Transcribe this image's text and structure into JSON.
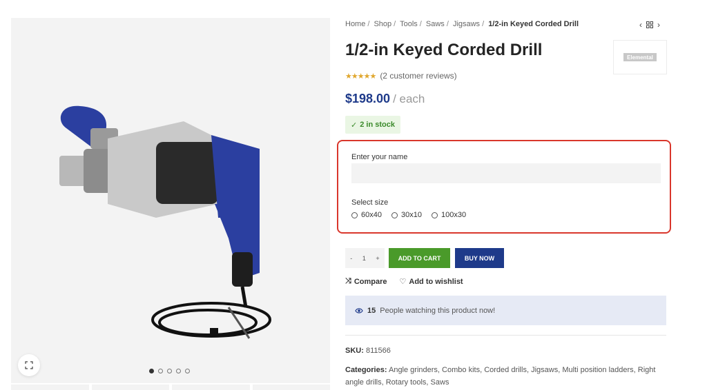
{
  "breadcrumb": [
    "Home",
    "Shop",
    "Tools",
    "Saws",
    "Jigsaws"
  ],
  "breadcrumb_current": "1/2-in Keyed Corded Drill",
  "brand": "Elemental",
  "product": {
    "title": "1/2-in Keyed Corded Drill",
    "rating": 4.5,
    "reviews": "(2 customer reviews)",
    "price": "$198.00",
    "unit": "/ each",
    "stock": "2 in stock"
  },
  "form": {
    "name_label": "Enter your name",
    "size_label": "Select size",
    "sizes": [
      "60x40",
      "30x10",
      "100x30"
    ]
  },
  "cart": {
    "minus": "-",
    "quantity": "1",
    "plus": "+",
    "add_to_cart": "ADD TO CART",
    "buy_now": "BUY NOW"
  },
  "actions": {
    "compare": "Compare",
    "wishlist": "Add to wishlist"
  },
  "watching": {
    "count": "15",
    "text": "People watching this product now!"
  },
  "meta": {
    "sku_label": "SKU:",
    "sku": "811566",
    "categories_label": "Categories:",
    "categories": [
      "Angle grinders",
      "Combo kits",
      "Corded drills",
      "Jigsaws",
      "Multi position ladders",
      "Right angle drills",
      "Rotary tools",
      "Saws"
    ]
  },
  "gallery": {
    "dot_count": 5,
    "active_dot": 0
  },
  "colors": {
    "accent_blue": "#1e3a8a",
    "cart_green": "#4a9a2a",
    "highlight_red": "#d9362b",
    "star": "#e0a72e"
  }
}
